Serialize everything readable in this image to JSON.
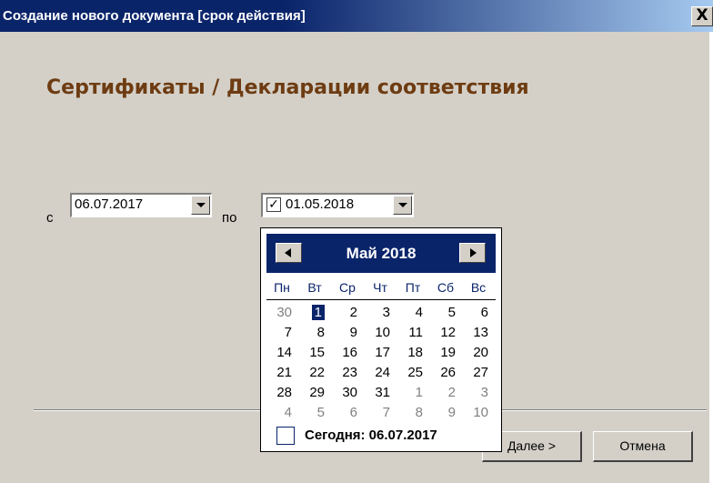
{
  "window": {
    "title": "Создание нового документа [срок действия]",
    "close_label": "X"
  },
  "heading": "Сертификаты / Декларации соответствия",
  "range": {
    "from_label": "с",
    "from_value": "06.07.2017",
    "to_label": "по",
    "to_value": "01.05.2018",
    "to_checked": true,
    "check_mark": "✓"
  },
  "buttons": {
    "next_label": "Далее >",
    "cancel_label": "Отмена"
  },
  "calendar": {
    "month_title": "Май 2018",
    "weekdays": [
      "Пн",
      "Вт",
      "Ср",
      "Чт",
      "Пт",
      "Сб",
      "Вс"
    ],
    "weeks": [
      [
        {
          "d": "30",
          "other": true
        },
        {
          "d": "1",
          "selected": true
        },
        {
          "d": "2"
        },
        {
          "d": "3"
        },
        {
          "d": "4"
        },
        {
          "d": "5"
        },
        {
          "d": "6"
        }
      ],
      [
        {
          "d": "7"
        },
        {
          "d": "8"
        },
        {
          "d": "9"
        },
        {
          "d": "10"
        },
        {
          "d": "11"
        },
        {
          "d": "12"
        },
        {
          "d": "13"
        }
      ],
      [
        {
          "d": "14"
        },
        {
          "d": "15"
        },
        {
          "d": "16"
        },
        {
          "d": "17"
        },
        {
          "d": "18"
        },
        {
          "d": "19"
        },
        {
          "d": "20"
        }
      ],
      [
        {
          "d": "21"
        },
        {
          "d": "22"
        },
        {
          "d": "23"
        },
        {
          "d": "24"
        },
        {
          "d": "25"
        },
        {
          "d": "26"
        },
        {
          "d": "27"
        }
      ],
      [
        {
          "d": "28"
        },
        {
          "d": "29"
        },
        {
          "d": "30"
        },
        {
          "d": "31"
        },
        {
          "d": "1",
          "other": true
        },
        {
          "d": "2",
          "other": true
        },
        {
          "d": "3",
          "other": true
        }
      ],
      [
        {
          "d": "4",
          "other": true
        },
        {
          "d": "5",
          "other": true
        },
        {
          "d": "6",
          "other": true
        },
        {
          "d": "7",
          "other": true
        },
        {
          "d": "8",
          "other": true
        },
        {
          "d": "9",
          "other": true
        },
        {
          "d": "10",
          "other": true
        }
      ]
    ],
    "today_label": "Сегодня: 06.07.2017"
  }
}
